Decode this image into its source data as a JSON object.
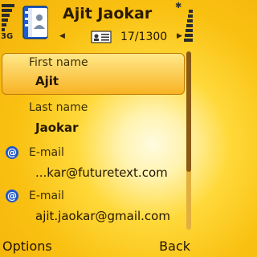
{
  "header": {
    "title": "Ajit Jaokar",
    "network": "3G",
    "counter": "17/1300",
    "nav_left": "◀",
    "nav_right": "▶",
    "bluetooth": "✱"
  },
  "fields": [
    {
      "label": "First name",
      "value": "Ajit",
      "icon": null,
      "selected": true
    },
    {
      "label": "Last name",
      "value": "Jaokar",
      "icon": null,
      "selected": false
    },
    {
      "label": "E-mail",
      "value": "...kar@futuretext.com",
      "icon": "email-icon",
      "selected": false
    },
    {
      "label": "E-mail",
      "value": "ajit.jaokar@gmail.com",
      "icon": "email-icon",
      "selected": false
    }
  ],
  "icons": {
    "email_glyph": "@"
  },
  "softkeys": {
    "left": "Options",
    "right": "Back"
  },
  "colors": {
    "highlight": "#f8b323",
    "background": "#f9c112",
    "email_icon": "#1f57c9"
  }
}
